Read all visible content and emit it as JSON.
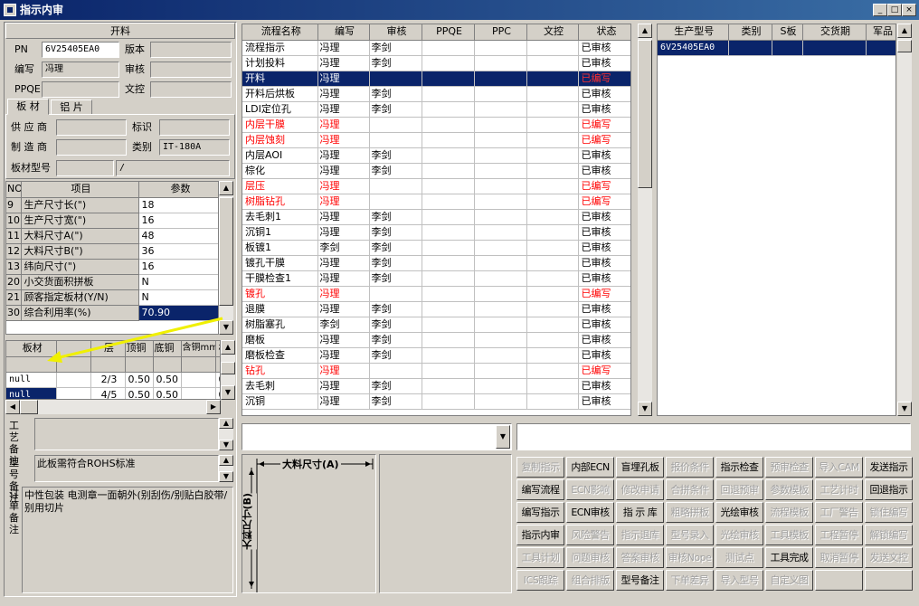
{
  "window": {
    "title": "指示内审"
  },
  "header": {
    "title": "开料"
  },
  "info": {
    "pn_label": "PN",
    "pn_value": "6V25405EA0",
    "version_label": "版本",
    "version_value": "",
    "editor_label": "编写",
    "editor_value": "冯理",
    "reviewer_label": "审核",
    "reviewer_value": "",
    "ppqe_label": "PPQE",
    "ppqe_value": "",
    "doc_label": "文控",
    "doc_value": ""
  },
  "tabs": [
    {
      "label": "板 材"
    },
    {
      "label": "铝 片"
    }
  ],
  "material": {
    "supplier_label": "供 应 商",
    "supplier_value": "",
    "mark_label": "标识",
    "mark_value": "",
    "maker_label": "制 造 商",
    "maker_value": "",
    "category_label": "类别",
    "category_value": "IT-180A",
    "model_label": "板材型号",
    "model_value": "",
    "model_value2": "/"
  },
  "params": {
    "headers": [
      "NO",
      "项目",
      "参数"
    ],
    "rows": [
      {
        "no": "9",
        "item": "生产尺寸长(\")",
        "value": "18"
      },
      {
        "no": "10",
        "item": "生产尺寸宽(\")",
        "value": "16"
      },
      {
        "no": "11",
        "item": "大料尺寸A(\")",
        "value": "48"
      },
      {
        "no": "12",
        "item": "大料尺寸B(\")",
        "value": "36"
      },
      {
        "no": "13",
        "item": "纬向尺寸(\")",
        "value": "16"
      },
      {
        "no": "20",
        "item": "小交货面积拼板",
        "value": "N"
      },
      {
        "no": "21",
        "item": "顾客指定板材(Y/N)",
        "value": "N"
      },
      {
        "no": "30",
        "item": "综合利用率(%)",
        "value": "70.90"
      }
    ]
  },
  "board": {
    "headers": [
      "板材",
      "",
      "层",
      "顶铜",
      "底铜",
      "含铜mm",
      "板"
    ],
    "rows": [
      {
        "mat": "null",
        "c2": "",
        "layer": "2/3",
        "top": "0.50",
        "bottom": "0.50",
        "cu": "",
        "c7": "0"
      },
      {
        "mat": "null",
        "c2": "",
        "layer": "4/5",
        "top": "0.50",
        "bottom": "0.50",
        "cu": "",
        "c7": "0"
      }
    ]
  },
  "remarks": {
    "process_label": "工艺备注",
    "process_value": "",
    "model_label": "型号备注",
    "model_value": "此板需符合ROHS标准",
    "order_label": "订单备注",
    "order_value": "中性包装 电测章一面朝外(别刮伤/别贴白胶带/别用切片"
  },
  "flow": {
    "headers": [
      "流程名称",
      "编写",
      "审核",
      "PPQE",
      "PPC",
      "文控",
      "状态"
    ],
    "rows": [
      {
        "name": "流程指示",
        "editor": "冯理",
        "reviewer": "李剑",
        "status": "已审核",
        "kind": "normal"
      },
      {
        "name": "计划投料",
        "editor": "冯理",
        "reviewer": "李剑",
        "status": "已审核",
        "kind": "normal"
      },
      {
        "name": "开料",
        "editor": "冯理",
        "reviewer": "",
        "status": "已编写",
        "kind": "sel"
      },
      {
        "name": "开料后烘板",
        "editor": "冯理",
        "reviewer": "李剑",
        "status": "已审核",
        "kind": "normal"
      },
      {
        "name": "LDI定位孔",
        "editor": "冯理",
        "reviewer": "李剑",
        "status": "已审核",
        "kind": "normal"
      },
      {
        "name": "内层干膜",
        "editor": "冯理",
        "reviewer": "",
        "status": "已编写",
        "kind": "red"
      },
      {
        "name": "内层蚀刻",
        "editor": "冯理",
        "reviewer": "",
        "status": "已编写",
        "kind": "red"
      },
      {
        "name": "内层AOI",
        "editor": "冯理",
        "reviewer": "李剑",
        "status": "已审核",
        "kind": "normal"
      },
      {
        "name": "棕化",
        "editor": "冯理",
        "reviewer": "李剑",
        "status": "已审核",
        "kind": "normal"
      },
      {
        "name": "层压",
        "editor": "冯理",
        "reviewer": "",
        "status": "已编写",
        "kind": "red"
      },
      {
        "name": "树脂钻孔",
        "editor": "冯理",
        "reviewer": "",
        "status": "已编写",
        "kind": "red"
      },
      {
        "name": "去毛刺1",
        "editor": "冯理",
        "reviewer": "李剑",
        "status": "已审核",
        "kind": "normal"
      },
      {
        "name": "沉铜1",
        "editor": "冯理",
        "reviewer": "李剑",
        "status": "已审核",
        "kind": "normal"
      },
      {
        "name": "板镀1",
        "editor": "李剑",
        "reviewer": "李剑",
        "status": "已审核",
        "kind": "normal"
      },
      {
        "name": "镀孔干膜",
        "editor": "冯理",
        "reviewer": "李剑",
        "status": "已审核",
        "kind": "normal"
      },
      {
        "name": "干膜检查1",
        "editor": "冯理",
        "reviewer": "李剑",
        "status": "已审核",
        "kind": "normal"
      },
      {
        "name": "镀孔",
        "editor": "冯理",
        "reviewer": "",
        "status": "已编写",
        "kind": "red"
      },
      {
        "name": "退膜",
        "editor": "冯理",
        "reviewer": "李剑",
        "status": "已审核",
        "kind": "normal"
      },
      {
        "name": "树脂塞孔",
        "editor": "李剑",
        "reviewer": "李剑",
        "status": "已审核",
        "kind": "normal"
      },
      {
        "name": "磨板",
        "editor": "冯理",
        "reviewer": "李剑",
        "status": "已审核",
        "kind": "normal"
      },
      {
        "name": "磨板检查",
        "editor": "冯理",
        "reviewer": "李剑",
        "status": "已审核",
        "kind": "normal"
      },
      {
        "name": "钻孔",
        "editor": "冯理",
        "reviewer": "",
        "status": "已编写",
        "kind": "red"
      },
      {
        "name": "去毛刺",
        "editor": "冯理",
        "reviewer": "李剑",
        "status": "已审核",
        "kind": "normal"
      },
      {
        "name": "沉铜",
        "editor": "冯理",
        "reviewer": "李剑",
        "status": "已审核",
        "kind": "normal"
      }
    ]
  },
  "production": {
    "headers": [
      "生产型号",
      "类别",
      "S板",
      "交货期",
      "军品"
    ],
    "rows": [
      {
        "model": "6V25405EA0",
        "cat": "",
        "s": "",
        "due": "",
        "mil": ""
      }
    ]
  },
  "diagram": {
    "dim_a": "大料尺寸(A)",
    "dim_b": "大料尺寸(B)"
  },
  "actions": [
    [
      {
        "label": "复制指示",
        "enabled": false
      },
      {
        "label": "内部ECN",
        "enabled": true
      },
      {
        "label": "盲埋孔板",
        "enabled": true
      },
      {
        "label": "报价条件",
        "enabled": false
      },
      {
        "label": "指示检查",
        "enabled": true
      },
      {
        "label": "预审检查",
        "enabled": false
      },
      {
        "label": "导入CAM",
        "enabled": false
      },
      {
        "label": "发送指示",
        "enabled": true
      }
    ],
    [
      {
        "label": "编写流程",
        "enabled": true
      },
      {
        "label": "ECN影响",
        "enabled": false
      },
      {
        "label": "修改申请",
        "enabled": false
      },
      {
        "label": "合拼条件",
        "enabled": false
      },
      {
        "label": "回退预审",
        "enabled": false
      },
      {
        "label": "参数模板",
        "enabled": false
      },
      {
        "label": "工艺计时",
        "enabled": false
      },
      {
        "label": "回退指示",
        "enabled": true
      }
    ],
    [
      {
        "label": "编写指示",
        "enabled": true
      },
      {
        "label": "ECN审核",
        "enabled": true
      },
      {
        "label": "指 示 库",
        "enabled": true
      },
      {
        "label": "粗略拼板",
        "enabled": false
      },
      {
        "label": "光绘审核",
        "enabled": true
      },
      {
        "label": "流程模板",
        "enabled": false
      },
      {
        "label": "工厂警告",
        "enabled": false
      },
      {
        "label": "锁住编写",
        "enabled": false
      }
    ],
    [
      {
        "label": "指示内审",
        "enabled": true
      },
      {
        "label": "风险警告",
        "enabled": false
      },
      {
        "label": "指示退库",
        "enabled": false
      },
      {
        "label": "型号录入",
        "enabled": false
      },
      {
        "label": "光绘审核",
        "enabled": false
      },
      {
        "label": "工具模板",
        "enabled": false
      },
      {
        "label": "工程暂停",
        "enabled": false
      },
      {
        "label": "解锁编写",
        "enabled": false
      }
    ],
    [
      {
        "label": "工具计划",
        "enabled": false
      },
      {
        "label": "问题审核",
        "enabled": false
      },
      {
        "label": "答案审核",
        "enabled": false
      },
      {
        "label": "审核Nope",
        "enabled": false
      },
      {
        "label": "测试点",
        "enabled": false
      },
      {
        "label": "工具完成",
        "enabled": true
      },
      {
        "label": "取消暂停",
        "enabled": false
      },
      {
        "label": "发送文控",
        "enabled": false
      }
    ],
    [
      {
        "label": "ICS跟踪",
        "enabled": false
      },
      {
        "label": "组合排版",
        "enabled": false
      },
      {
        "label": "型号备注",
        "enabled": true
      },
      {
        "label": "下单差异",
        "enabled": false
      },
      {
        "label": "导入型号",
        "enabled": false
      },
      {
        "label": "自定义图",
        "enabled": false
      },
      {
        "label": "",
        "enabled": false
      },
      {
        "label": "",
        "enabled": false
      }
    ]
  ],
  "colors": {
    "selection": "#0a246a",
    "written": "#ff0000",
    "arrow": "#f0f000"
  }
}
